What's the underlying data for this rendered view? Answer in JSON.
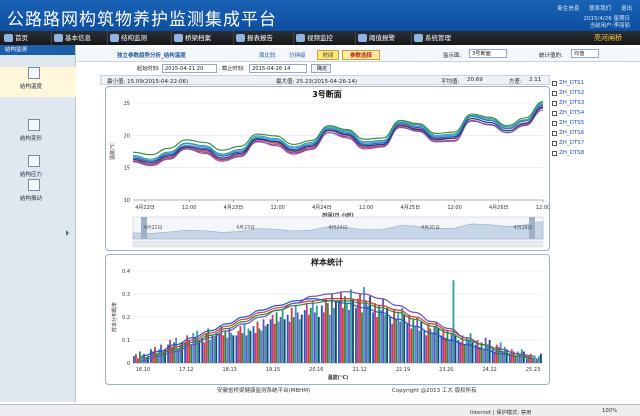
{
  "header": {
    "title": "公路路网构筑物养护监测集成平台",
    "links": [
      "新生信息",
      "联系我们",
      "退出"
    ],
    "date": "2015/4/26 星期日",
    "user": "当前用户:李丽丽"
  },
  "nav": {
    "items": [
      "首页",
      "基本信息",
      "结构监测",
      "桥梁档案",
      "报表报告",
      "视频监控",
      "阈值报警",
      "系统管理"
    ],
    "bridge_name": "亮河闸桥"
  },
  "sidebar": {
    "heading": "结构监测",
    "items": [
      "结构温度",
      "结构变形",
      "结构应力",
      "结构振动"
    ]
  },
  "toolbar": {
    "tab_trend": "独立参数趋势分析_结构温度",
    "tab_day": "周比较",
    "tab_minute": "分钟级",
    "tab_hour": "时间",
    "param_select_btn": "参数选择",
    "section_label": "监示面:",
    "section_value": "3号断面",
    "stat_type_label": "统计值的:",
    "stat_type_value": "均值"
  },
  "time_range": {
    "start_label": "起始时刻:",
    "start_value": "2015-04-21 20",
    "end_label": "截止时刻:",
    "end_value": "2015-04-26 14",
    "confirm_btn": "确定"
  },
  "stats": {
    "min": "最小值: 15.09(2015-04-22-06)",
    "max": "最大值: 25.23(2015-04-26-14)",
    "avg_label": "平均值:",
    "avg": "20.69",
    "var_label": "方差:",
    "var": "2.11"
  },
  "colors": {
    "header": "#0f52a3",
    "nav": "#1f2226",
    "accent": "#f7d23a",
    "legend_text": "#2050c0"
  },
  "chart_data": [
    {
      "type": "line",
      "title": "3号断面",
      "xlabel": "时间(日 小时)",
      "ylabel": "温度/℃",
      "ylim": [
        10,
        25
      ],
      "y_ticks": [
        "10",
        "15",
        "20",
        "25"
      ],
      "x_ticks": [
        "4月22日",
        "12:00",
        "4月23日",
        "12:00",
        "4月24日",
        "12:00",
        "4月25日",
        "12:00",
        "4月26日",
        "12:00"
      ],
      "navigator_labels": [
        "4月22日",
        "4月23日",
        "4月24日",
        "4月25日",
        "4月26日"
      ],
      "legend_placement": "right",
      "series": [
        {
          "name": "ZH_DTS1",
          "color": "#2058c8",
          "values": [
            16.5,
            16.0,
            17.0,
            18.4,
            18.0,
            16.8,
            17.4,
            19.5,
            19.1,
            17.8,
            18.5,
            21.0,
            20.3,
            18.6,
            18.8,
            21.8,
            21.2,
            19.6,
            19.8,
            22.9,
            22.3,
            21.0,
            22.2,
            24.6
          ]
        },
        {
          "name": "ZH_DTS2",
          "color": "#c83a78",
          "values": [
            15.9,
            15.3,
            16.3,
            17.9,
            17.2,
            16.0,
            16.7,
            19.1,
            18.4,
            17.1,
            17.8,
            20.4,
            19.6,
            17.9,
            18.2,
            21.3,
            20.6,
            19.0,
            19.1,
            22.3,
            21.6,
            20.4,
            21.5,
            24.2
          ]
        },
        {
          "name": "ZH_DTS3",
          "color": "#d63a3a",
          "values": [
            16.2,
            15.6,
            16.6,
            18.1,
            17.6,
            16.3,
            17.0,
            19.3,
            18.8,
            17.5,
            18.1,
            20.7,
            20.0,
            18.3,
            18.5,
            21.6,
            21.0,
            19.3,
            19.5,
            22.6,
            22.0,
            20.7,
            21.9,
            24.4
          ]
        },
        {
          "name": "ZH_DTS4",
          "color": "#2c8a3a",
          "values": [
            17.4,
            17.0,
            18.0,
            19.3,
            18.9,
            17.7,
            18.3,
            20.2,
            19.9,
            18.6,
            19.2,
            21.5,
            20.9,
            19.4,
            19.6,
            22.3,
            21.8,
            20.3,
            20.5,
            23.3,
            22.8,
            21.5,
            22.7,
            25.2
          ]
        },
        {
          "name": "ZH_DTS5",
          "color": "#4a8fd6",
          "values": [
            16.7,
            16.1,
            17.2,
            18.7,
            18.2,
            16.9,
            17.6,
            19.7,
            19.3,
            18.0,
            18.7,
            21.1,
            20.5,
            18.8,
            19.0,
            22.0,
            21.4,
            19.8,
            20.0,
            23.0,
            22.4,
            21.1,
            22.3,
            24.8
          ]
        },
        {
          "name": "ZH_DTS6",
          "color": "#6a52b8",
          "values": [
            16.0,
            15.5,
            16.4,
            17.9,
            17.4,
            16.2,
            16.8,
            19.0,
            18.6,
            17.3,
            17.9,
            20.4,
            19.8,
            18.1,
            18.3,
            21.2,
            20.7,
            19.1,
            19.2,
            22.2,
            21.7,
            20.4,
            21.6,
            23.9
          ]
        },
        {
          "name": "ZH_DTS7",
          "color": "#2aa09a",
          "values": [
            16.9,
            16.3,
            17.4,
            18.8,
            18.4,
            17.1,
            17.8,
            19.9,
            19.5,
            18.2,
            18.9,
            21.3,
            20.7,
            19.0,
            19.2,
            22.1,
            21.6,
            20.0,
            20.2,
            23.1,
            22.6,
            21.3,
            22.4,
            25.0
          ]
        },
        {
          "name": "ZH_DTS8",
          "color": "#1a3f7a",
          "values": [
            16.3,
            15.8,
            16.8,
            18.2,
            17.8,
            16.5,
            17.2,
            19.4,
            19.0,
            17.6,
            18.3,
            20.8,
            20.1,
            18.4,
            18.6,
            21.5,
            20.9,
            19.4,
            19.6,
            22.6,
            22.0,
            20.7,
            21.8,
            24.3
          ]
        }
      ]
    },
    {
      "type": "bar",
      "title": "样本统计",
      "xlabel": "温度(℃)",
      "ylabel": "样本分布概率",
      "ylim": [
        0,
        0.4
      ],
      "y_ticks": [
        "0",
        "0.1",
        "0.2",
        "0.3",
        "0.4"
      ],
      "x_ticks": [
        "16.10",
        "17.12",
        "18.13",
        "19.15",
        "20.16",
        "21.12",
        "22.19",
        "23.20",
        "24.22",
        "25.23"
      ],
      "series_colors": [
        "#2058c8",
        "#c83a78",
        "#d63a3a",
        "#2c8a3a",
        "#4a8fd6",
        "#6a52b8",
        "#2aa09a",
        "#1a3f7a"
      ],
      "group_values": [
        [
          0.03,
          0.04,
          0.02,
          0.05,
          0.03,
          0.04,
          0.02,
          0.03
        ],
        [
          0.06,
          0.05,
          0.07,
          0.04,
          0.06,
          0.08,
          0.05,
          0.06
        ],
        [
          0.08,
          0.1,
          0.07,
          0.09,
          0.11,
          0.06,
          0.08,
          0.09
        ],
        [
          0.09,
          0.12,
          0.1,
          0.08,
          0.13,
          0.11,
          0.14,
          0.1
        ],
        [
          0.11,
          0.09,
          0.13,
          0.15,
          0.1,
          0.12,
          0.11,
          0.13
        ],
        [
          0.13,
          0.16,
          0.12,
          0.14,
          0.11,
          0.15,
          0.13,
          0.12
        ],
        [
          0.12,
          0.14,
          0.16,
          0.13,
          0.17,
          0.12,
          0.15,
          0.14
        ],
        [
          0.16,
          0.13,
          0.18,
          0.15,
          0.14,
          0.19,
          0.16,
          0.17
        ],
        [
          0.19,
          0.21,
          0.17,
          0.22,
          0.18,
          0.2,
          0.23,
          0.19
        ],
        [
          0.21,
          0.18,
          0.24,
          0.2,
          0.25,
          0.22,
          0.19,
          0.21
        ],
        [
          0.23,
          0.26,
          0.21,
          0.24,
          0.27,
          0.22,
          0.25,
          0.2
        ],
        [
          0.25,
          0.22,
          0.28,
          0.26,
          0.21,
          0.3,
          0.24,
          0.27
        ],
        [
          0.27,
          0.31,
          0.24,
          0.29,
          0.26,
          0.23,
          0.32,
          0.28
        ],
        [
          0.24,
          0.28,
          0.3,
          0.22,
          0.33,
          0.27,
          0.25,
          0.29
        ],
        [
          0.22,
          0.26,
          0.2,
          0.25,
          0.23,
          0.28,
          0.21,
          0.24
        ],
        [
          0.2,
          0.17,
          0.23,
          0.19,
          0.22,
          0.18,
          0.24,
          0.21
        ],
        [
          0.17,
          0.21,
          0.15,
          0.19,
          0.16,
          0.2,
          0.14,
          0.18
        ],
        [
          0.14,
          0.12,
          0.17,
          0.15,
          0.13,
          0.16,
          0.18,
          0.15
        ],
        [
          0.12,
          0.15,
          0.11,
          0.14,
          0.1,
          0.13,
          0.36,
          0.12
        ],
        [
          0.1,
          0.09,
          0.12,
          0.08,
          0.11,
          0.1,
          0.13,
          0.09
        ],
        [
          0.08,
          0.1,
          0.07,
          0.09,
          0.06,
          0.11,
          0.08,
          0.1
        ],
        [
          0.06,
          0.05,
          0.08,
          0.07,
          0.09,
          0.05,
          0.07,
          0.06
        ],
        [
          0.04,
          0.06,
          0.05,
          0.03,
          0.05,
          0.04,
          0.06,
          0.05
        ],
        [
          0.02,
          0.03,
          0.04,
          0.02,
          0.03,
          0.02,
          0.03,
          0.04
        ]
      ],
      "curves": [
        [
          0.02,
          0.04,
          0.07,
          0.1,
          0.13,
          0.16,
          0.19,
          0.22,
          0.24,
          0.26,
          0.27,
          0.28,
          0.28,
          0.27,
          0.25,
          0.23,
          0.2,
          0.17,
          0.14,
          0.11,
          0.08,
          0.06,
          0.04,
          0.02
        ],
        [
          0.03,
          0.05,
          0.08,
          0.11,
          0.14,
          0.17,
          0.2,
          0.23,
          0.25,
          0.27,
          0.28,
          0.27,
          0.26,
          0.24,
          0.22,
          0.19,
          0.16,
          0.13,
          0.1,
          0.08,
          0.06,
          0.04,
          0.03,
          0.02
        ],
        [
          0.01,
          0.03,
          0.05,
          0.08,
          0.11,
          0.14,
          0.17,
          0.2,
          0.23,
          0.26,
          0.29,
          0.3,
          0.31,
          0.3,
          0.28,
          0.25,
          0.22,
          0.18,
          0.15,
          0.11,
          0.08,
          0.06,
          0.04,
          0.03
        ],
        [
          0.02,
          0.04,
          0.06,
          0.09,
          0.12,
          0.15,
          0.18,
          0.21,
          0.23,
          0.25,
          0.26,
          0.27,
          0.27,
          0.26,
          0.24,
          0.22,
          0.19,
          0.16,
          0.13,
          0.1,
          0.08,
          0.05,
          0.03,
          0.02
        ]
      ]
    }
  ],
  "footer": {
    "system": "安徽省桥梁健康监测系统平台(MBHM)",
    "copyright": "Copyright @2013 工大 版权所有"
  },
  "statusbar": {
    "internet": "Internet | 保护模式: 禁用",
    "zoom": "100%"
  }
}
